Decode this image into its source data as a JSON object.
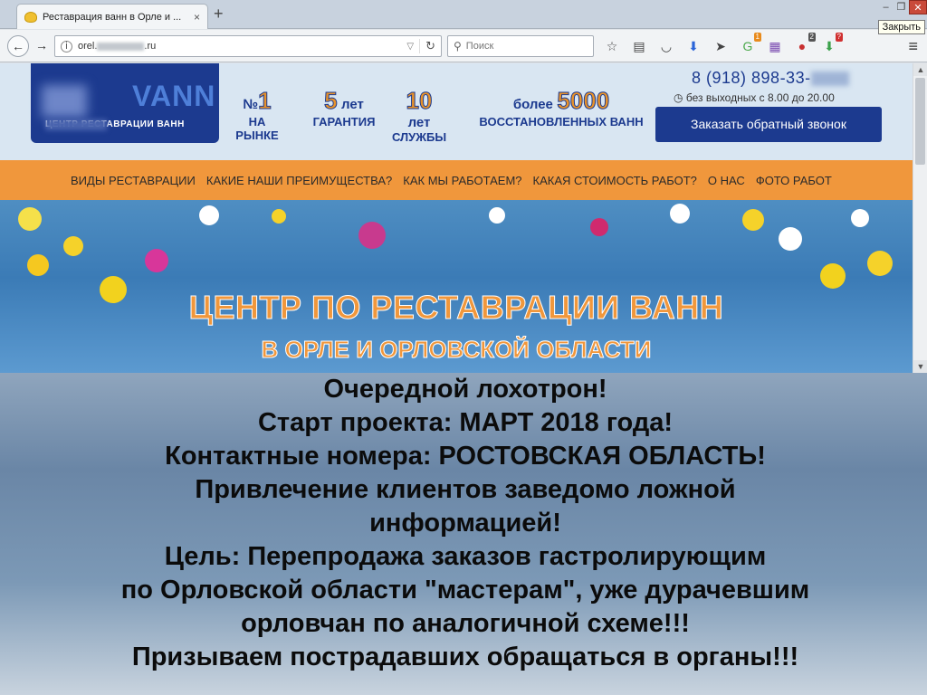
{
  "browser": {
    "tab_title": "Реставрация ванн в Орле и ...",
    "tab_close": "×",
    "new_tab": "+",
    "url_prefix": "orel.",
    "url_suffix": ".ru",
    "search_placeholder": "Поиск",
    "tooltip": "Закрыть",
    "toolbar_badges": [
      "1",
      "2",
      "ABP",
      "?"
    ]
  },
  "header": {
    "logo_name": "VANN",
    "logo_sub": "ЦЕНТР РЕСТАВРАЦИИ ВАНН",
    "stats": [
      {
        "big": "1",
        "prefix": "№",
        "label": "НА\nРЫНКЕ"
      },
      {
        "big": "5",
        "suffix": "лет",
        "label": "ГАРАНТИЯ"
      },
      {
        "big": "10",
        "label_lines": [
          "лет",
          "СЛУЖБЫ"
        ]
      },
      {
        "prefix": "более",
        "big": "5000",
        "label": "ВОССТАНОВЛЕННЫХ ВАНН"
      }
    ],
    "phone": "8 (918) 898-33-",
    "hours": "без выходных с 8.00 до 20.00",
    "callback_button": "Заказать обратный звонок"
  },
  "menu": [
    "ВИДЫ РЕСТАВРАЦИИ",
    "КАКИЕ НАШИ ПРЕИМУЩЕСТВА?",
    "КАК МЫ РАБОТАЕМ?",
    "КАКАЯ СТОИМОСТЬ РАБОТ?",
    "О НАС",
    "ФОТО РАБОТ"
  ],
  "hero": {
    "title": "ЦЕНТР ПО РЕСТАВРАЦИИ ВАНН",
    "subtitle": "В ОРЛЕ И ОРЛОВСКОЙ ОБЛАСТИ"
  },
  "warning": {
    "lines": [
      "Очередной лохотрон!",
      "Старт проекта: МАРТ 2018 года!",
      "Контактные номера: РОСТОВСКАЯ ОБЛАСТЬ!",
      "Привлечение клиентов заведомо ложной",
      "информацией!",
      "Цель: Перепродажа заказов гастролирующим",
      "по Орловской области \"мастерам\", уже дурачевшим",
      "орловчан по аналогичной схеме!!!",
      "Призываем пострадавших обращаться в органы!!!"
    ]
  },
  "colors": {
    "brand_blue": "#1c3a8f",
    "accent_orange": "#f0973c",
    "header_bg": "#d9e6f2"
  }
}
